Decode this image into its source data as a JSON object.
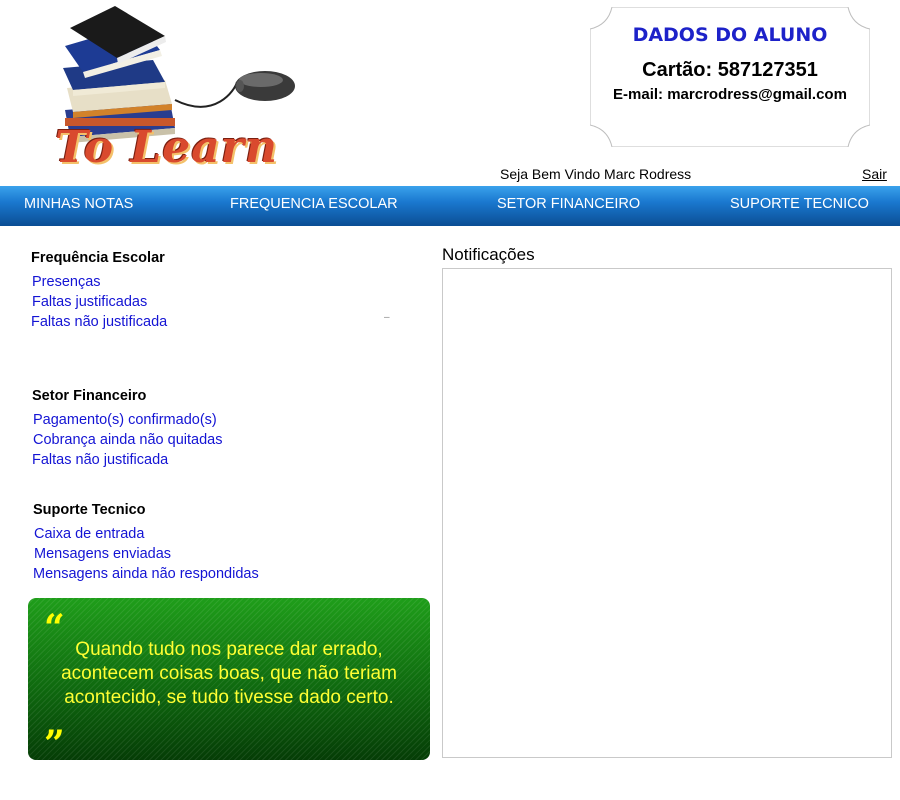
{
  "header": {
    "logo_text": "To Learn",
    "student_card": {
      "title": "DADOS DO ALUNO",
      "card_number": "Cartão: 587127351",
      "email": "E-mail: marcrodress@gmail.com"
    },
    "welcome": "Seja Bem Vindo Marc Rodress",
    "logout_label": "Sair"
  },
  "nav": {
    "items": [
      {
        "label": "MINHAS NOTAS"
      },
      {
        "label": "FREQUENCIA ESCOLAR"
      },
      {
        "label": "SETOR FINANCEIRO"
      },
      {
        "label": "SUPORTE TECNICO"
      }
    ]
  },
  "sidebar": {
    "sections": [
      {
        "title": "Frequência Escolar",
        "links": [
          "Presenças",
          "Faltas justificadas",
          "Faltas não justificada"
        ]
      },
      {
        "title": "Setor Financeiro",
        "links": [
          "Pagamento(s) confirmado(s)",
          "Cobrança ainda não quitadas",
          "Faltas não justificada"
        ]
      },
      {
        "title": "Suporte Tecnico",
        "links": [
          "Caixa de entrada",
          "Mensagens enviadas",
          "Mensagens ainda não respondidas"
        ]
      }
    ],
    "dash": "–"
  },
  "quote": {
    "open_mark": "“",
    "text": "Quando tudo nos parece dar errado, acontecem coisas boas, que não teriam acontecido, se tudo tivesse dado certo.",
    "close_mark": "”"
  },
  "notifications": {
    "title": "Notificações"
  },
  "colors": {
    "nav_gradient_top": "#3aa2ec",
    "nav_gradient_bottom": "#0b4e94",
    "link": "#1414d4",
    "card_title": "#1d22c9",
    "quote_text": "#ffff33",
    "quote_bg": "#1f9e1a"
  },
  "icons": [
    "books-icon",
    "computer-mouse-icon"
  ]
}
